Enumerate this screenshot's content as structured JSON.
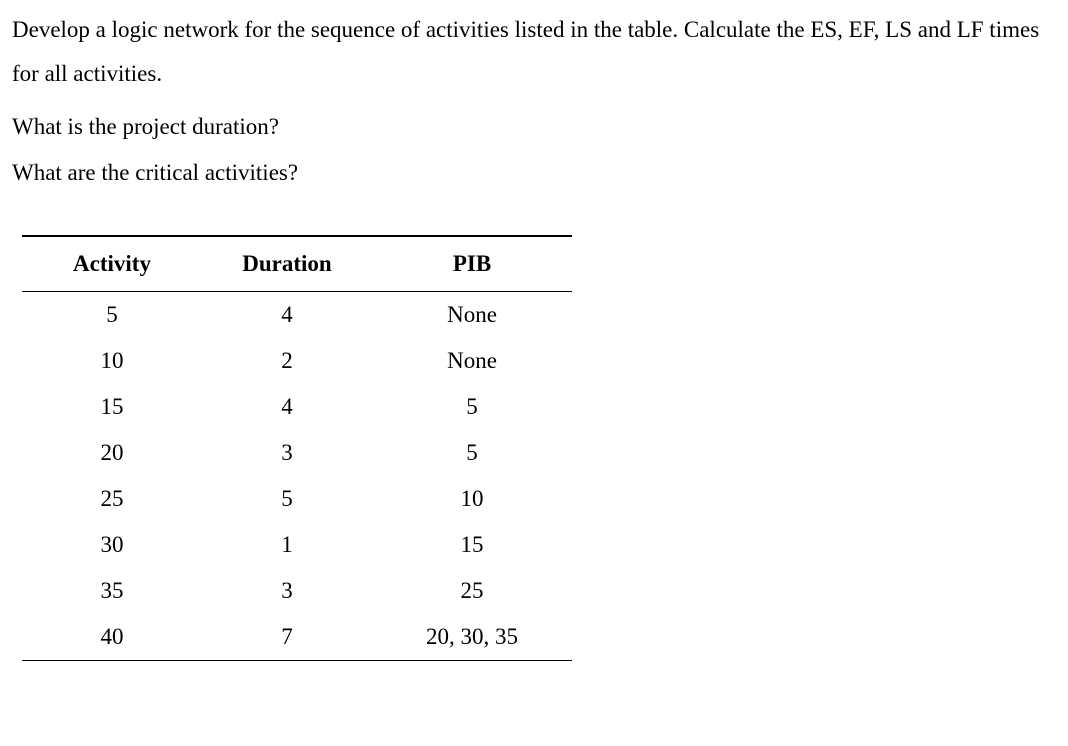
{
  "intro": {
    "p1": "Develop a logic network for the sequence of activities listed in the table.  Calculate the ES, EF, LS and LF times for all activities.",
    "q1": "What is the project duration?",
    "q2": "What are the critical activities?"
  },
  "table": {
    "headers": {
      "activity": "Activity",
      "duration": "Duration",
      "pib": "PIB"
    },
    "rows": [
      {
        "activity": "5",
        "duration": "4",
        "pib": "None"
      },
      {
        "activity": "10",
        "duration": "2",
        "pib": "None"
      },
      {
        "activity": "15",
        "duration": "4",
        "pib": "5"
      },
      {
        "activity": "20",
        "duration": "3",
        "pib": "5"
      },
      {
        "activity": "25",
        "duration": "5",
        "pib": "10"
      },
      {
        "activity": "30",
        "duration": "1",
        "pib": "15"
      },
      {
        "activity": "35",
        "duration": "3",
        "pib": "25"
      },
      {
        "activity": "40",
        "duration": "7",
        "pib": "20, 30, 35"
      }
    ]
  }
}
